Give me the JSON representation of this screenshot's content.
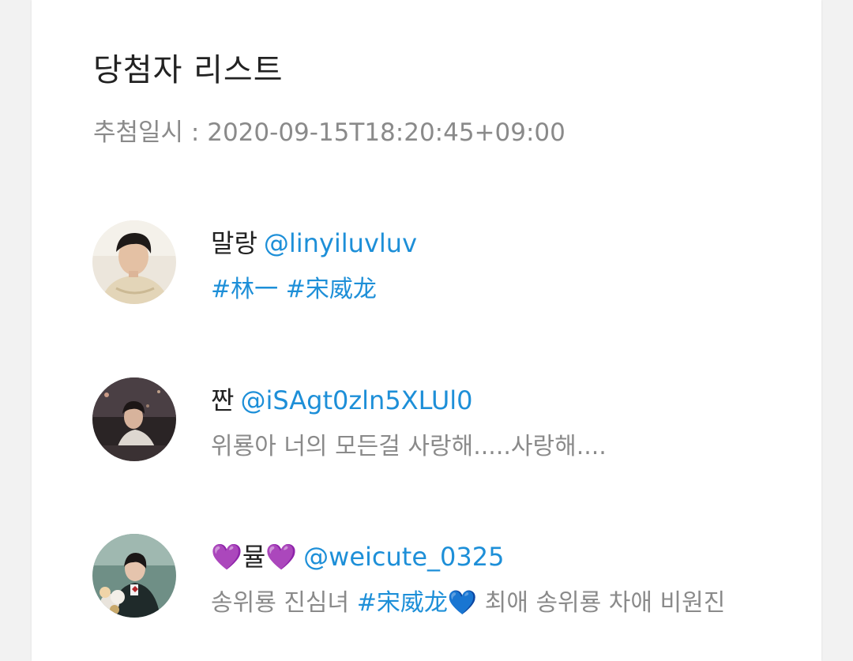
{
  "header": {
    "title": "당첨자 리스트",
    "draw_date_label": "추첨일시 : ",
    "draw_date_value": "2020-09-15T18:20:45+09:00"
  },
  "colors": {
    "link": "#1d8fd8",
    "muted": "#8a8a8a",
    "text": "#222222"
  },
  "winners": [
    {
      "name": "말랑",
      "handle": "@linyiluvluv",
      "message": {
        "tag1": "#林一",
        "sep": " ",
        "tag2": "#宋威龙"
      }
    },
    {
      "name": "짠",
      "handle": "@iSAgt0zln5XLUl0",
      "message": {
        "text": "위룡아 너의 모든걸 사랑해.....사랑해...."
      }
    },
    {
      "name_prefix": "💜",
      "name": "뮬",
      "name_suffix": "💜",
      "handle": "@weicute_0325",
      "message": {
        "pre": "송위룡 진심녀 ",
        "tag": "#宋威龙",
        "emoji": "💙",
        "post": " 최애 송위룡 차애 비원진"
      }
    }
  ]
}
